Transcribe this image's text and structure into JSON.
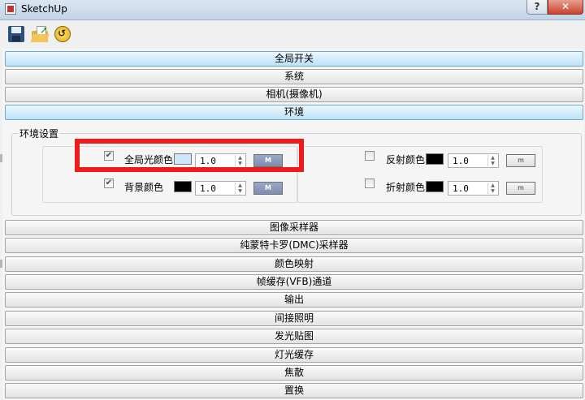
{
  "window": {
    "title": "SketchUp",
    "help_label": "?",
    "close_label": "✕"
  },
  "toolbar": {
    "buttons": [
      {
        "name": "save",
        "icon": "save-icon"
      },
      {
        "name": "open",
        "icon": "open-folder-icon"
      },
      {
        "name": "revert",
        "icon": "revert-icon"
      }
    ]
  },
  "rollouts_top": [
    {
      "label": "全局开关"
    },
    {
      "label": "系统"
    },
    {
      "label": "相机(摄像机)"
    },
    {
      "label": "环境"
    }
  ],
  "environment": {
    "group_title": "环境设置",
    "gi_color": {
      "label": "全局光颜色",
      "checked": true,
      "swatch": "#cde6fb",
      "value": "1.0",
      "map_label": "M"
    },
    "bg_color": {
      "label": "背景颜色",
      "checked": true,
      "swatch": "#000000",
      "value": "1.0",
      "map_label": "M"
    },
    "reflect_color": {
      "label": "反射颜色",
      "checked": false,
      "swatch": "#000000",
      "value": "1.0",
      "map_label": "m"
    },
    "refract_color": {
      "label": "折射颜色",
      "checked": false,
      "swatch": "#000000",
      "value": "1.0",
      "map_label": "m"
    }
  },
  "rollouts_bottom": [
    {
      "label": "图像采样器"
    },
    {
      "label": "纯蒙特卡罗(DMC)采样器"
    },
    {
      "label": "颜色映射"
    },
    {
      "label": "帧缓存(VFB)通道"
    },
    {
      "label": "输出"
    },
    {
      "label": "间接照明"
    },
    {
      "label": "发光贴图"
    },
    {
      "label": "灯光缓存"
    },
    {
      "label": "焦散"
    },
    {
      "label": "置换"
    }
  ],
  "colors": {
    "highlight": "#ef1b1b",
    "active_rollout": "#bfe3f7"
  }
}
